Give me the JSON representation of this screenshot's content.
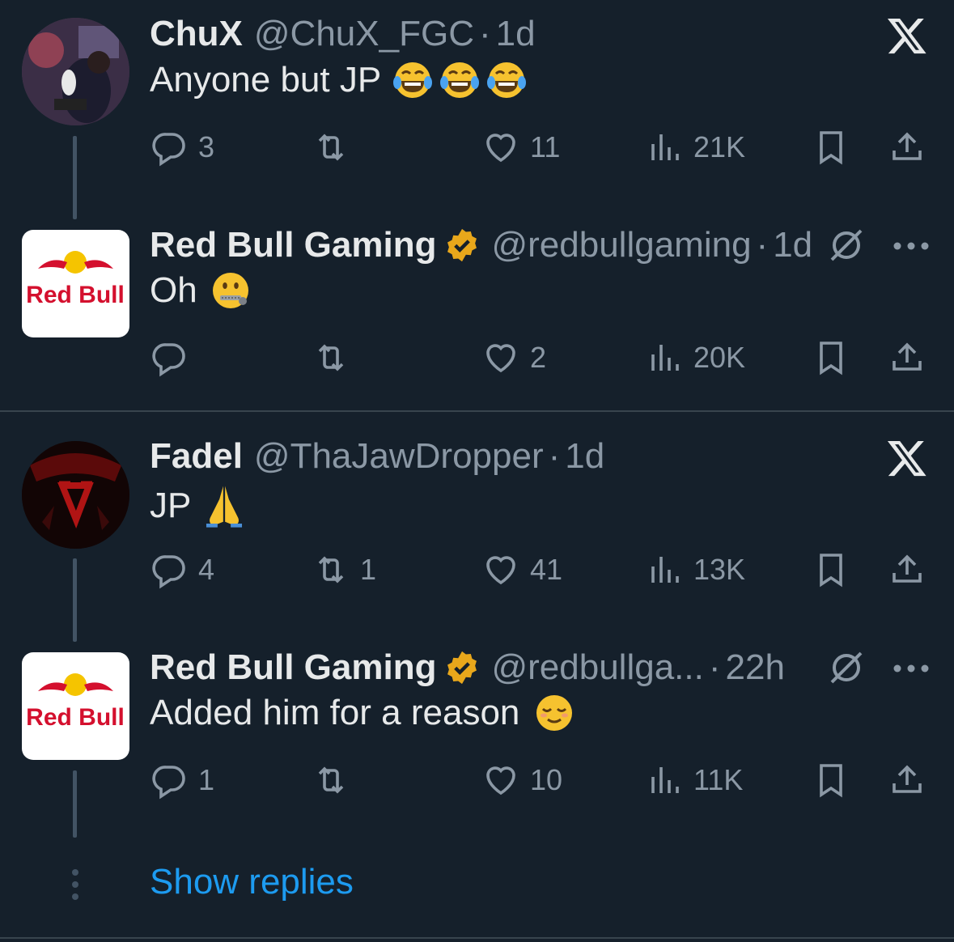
{
  "tweets": [
    {
      "name": "ChuX",
      "handle": "@ChuX_FGC",
      "time": "1d",
      "text": "Anyone but JP",
      "emojis": [
        "joy-emoji",
        "joy-emoji",
        "joy-emoji"
      ],
      "replies": "3",
      "retweets": "",
      "likes": "11",
      "views": "21K",
      "menu": "x-logo"
    },
    {
      "name": "Red Bull Gaming",
      "handle": "@redbullgaming",
      "time": "1d",
      "text": "Oh",
      "emojis": [
        "zipper-mouth-emoji"
      ],
      "replies": "",
      "retweets": "",
      "likes": "2",
      "views": "20K",
      "menu": "more"
    },
    {
      "name": "Fadel",
      "handle": "@ThaJawDropper",
      "time": "1d",
      "text": "JP",
      "emojis": [
        "folded-hands-emoji"
      ],
      "replies": "4",
      "retweets": "1",
      "likes": "41",
      "views": "13K",
      "menu": "x-logo"
    },
    {
      "name": "Red Bull Gaming",
      "handle": "@redbullga...",
      "time": "22h",
      "text": "Added him for a reason",
      "emojis": [
        "relieved-emoji"
      ],
      "replies": "1",
      "retweets": "",
      "likes": "10",
      "views": "11K",
      "menu": "more"
    }
  ],
  "avatar_text": {
    "redbull": "Red Bull"
  },
  "dot": "·",
  "show_replies": "Show replies",
  "colors": {
    "background": "#15202b",
    "accent": "#1d9bf0",
    "muted": "#8b98a5",
    "verified": "#e8a71b"
  }
}
